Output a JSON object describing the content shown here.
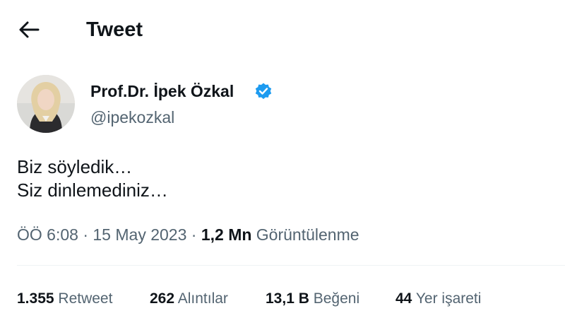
{
  "header": {
    "title": "Tweet",
    "back_icon": "arrow-left-icon"
  },
  "author": {
    "name": "Prof.Dr. İpek Özkal",
    "handle": "@ipekozkal",
    "verified_icon": "verified-badge-icon",
    "verified_color": "#1d9bf0"
  },
  "tweet": {
    "lines": [
      "Biz söyledik…",
      "Siz dinlemediniz…"
    ]
  },
  "meta": {
    "time": "ÖÖ 6:08",
    "separator": "·",
    "date": "15 May 2023",
    "views_count": "1,2 Mn",
    "views_label": "Görüntülenme"
  },
  "stats": [
    {
      "count": "1.355",
      "label": "Retweet"
    },
    {
      "count": "262",
      "label": "Alıntılar"
    },
    {
      "count": "13,1 B",
      "label": "Beğeni"
    },
    {
      "count": "44",
      "label": "Yer işareti"
    }
  ],
  "colors": {
    "text": "#0f1419",
    "secondary": "#536471",
    "accent": "#1d9bf0",
    "divider": "#eff3f4"
  }
}
